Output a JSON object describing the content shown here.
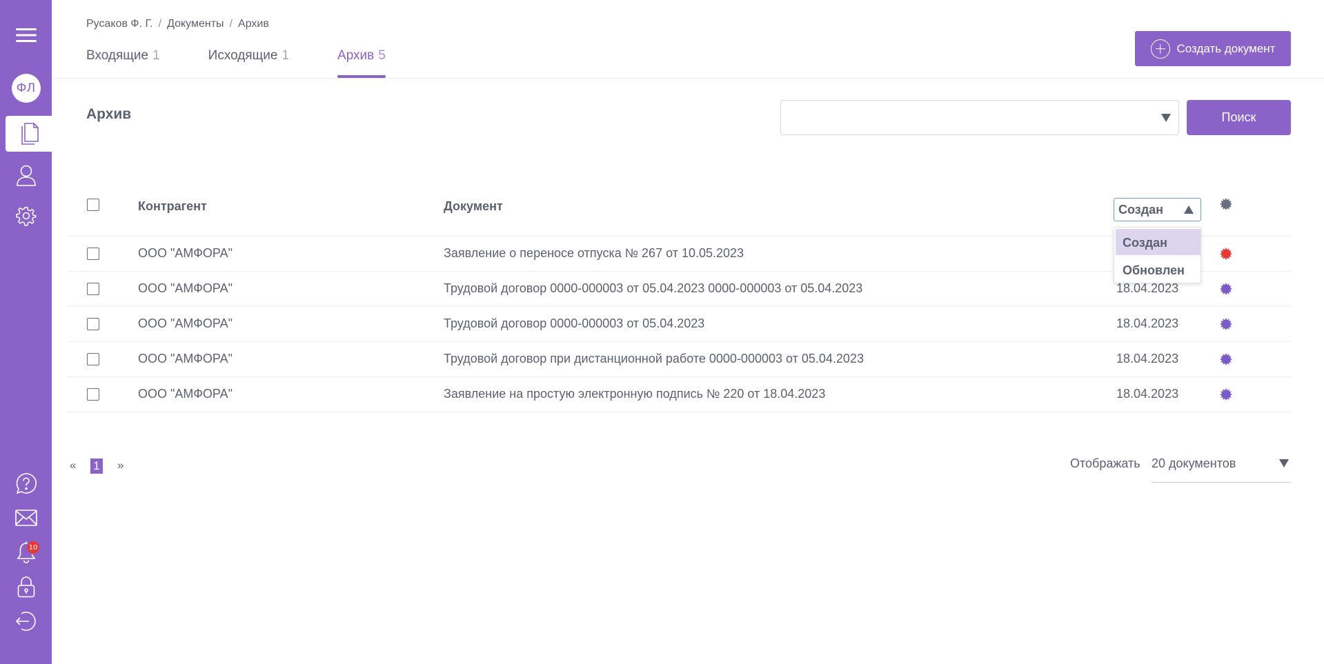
{
  "sidebar": {
    "avatar_initials": "ФЛ",
    "notification_count": "10",
    "icons": [
      "menu-icon",
      "document-icon",
      "user-icon",
      "gear-icon",
      "help-icon",
      "mail-icon",
      "bell-icon",
      "lock-icon",
      "logout-icon"
    ]
  },
  "breadcrumb": {
    "items": [
      "Русаков Ф. Г.",
      "Документы",
      "Архив"
    ],
    "separator": "/"
  },
  "tabs": [
    {
      "label": "Входящие",
      "count": "1"
    },
    {
      "label": "Исходящие",
      "count": "1"
    },
    {
      "label": "Архив",
      "count": "5"
    }
  ],
  "header": {
    "create_button_label": "Создать документ"
  },
  "section": {
    "title": "Архив",
    "search_button_label": "Поиск",
    "search_value": ""
  },
  "table": {
    "columns": [
      "Контрагент",
      "Документ"
    ],
    "sort": {
      "selected": "Создан",
      "options": [
        "Создан",
        "Обновлен"
      ]
    },
    "rows": [
      {
        "counterparty": "ООО \"АМФОРА\"",
        "document": "Заявление о переносе отпуска № 267 от 10.05.2023",
        "date": "",
        "status": "red"
      },
      {
        "counterparty": "ООО \"АМФОРА\"",
        "document": "Трудовой договор 0000-000003 от 05.04.2023 0000-000003 от 05.04.2023",
        "date": "18.04.2023",
        "status": "purple"
      },
      {
        "counterparty": "ООО \"АМФОРА\"",
        "document": "Трудовой договор 0000-000003 от 05.04.2023",
        "date": "18.04.2023",
        "status": "purple"
      },
      {
        "counterparty": "ООО \"АМФОРА\"",
        "document": "Трудовой договор при дистанционной работе 0000-000003 от 05.04.2023",
        "date": "18.04.2023",
        "status": "purple"
      },
      {
        "counterparty": "ООО \"АМФОРА\"",
        "document": "Заявление на простую электронную подпись № 220 от 18.04.2023",
        "date": "18.04.2023",
        "status": "purple"
      }
    ]
  },
  "pagination": {
    "prev": "«",
    "current": "1",
    "next": "»",
    "show_label": "Отображать",
    "per_page": "20 документов"
  },
  "colors": {
    "accent": "#8a62c8",
    "status_red": "#e53935",
    "status_purple": "#7b5cc7",
    "header_star": "#6b7080"
  }
}
